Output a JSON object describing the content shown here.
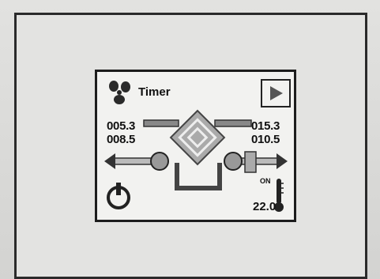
{
  "header": {
    "title": "Timer"
  },
  "readouts": {
    "left_top": "005.3",
    "left_bottom": "008.5",
    "right_top": "015.3",
    "right_bottom": "010.5"
  },
  "status": {
    "heater_state": "ON",
    "temperature": "22.0"
  },
  "icons": {
    "fan": "fan-icon",
    "play": "play-icon",
    "power": "power-icon",
    "thermometer": "thermometer-icon",
    "heat_exchanger": "heat-exchanger-icon"
  }
}
